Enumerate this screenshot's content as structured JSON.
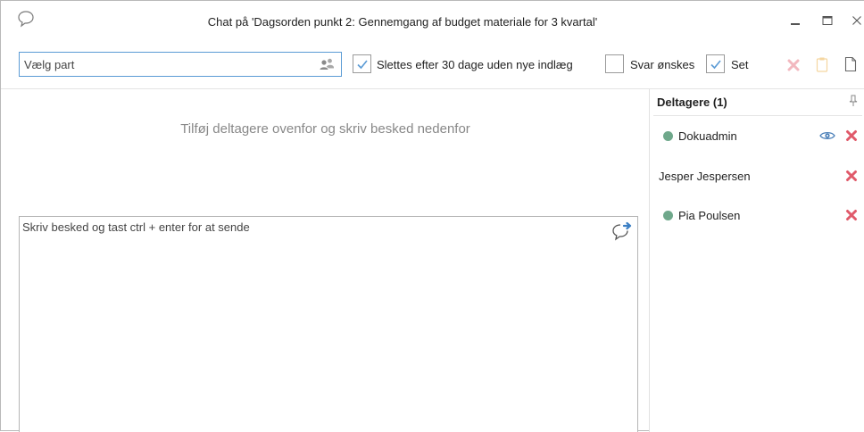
{
  "window": {
    "title": "Chat på 'Dagsorden punkt 2: Gennemgang af budget materiale for 3 kvartal'",
    "icon": "chat-bubble-icon",
    "controls": [
      "minimize-icon",
      "maximize-icon",
      "close-icon"
    ]
  },
  "toolbar": {
    "party_placeholder": "Vælg part",
    "party_icon": "people-icon",
    "delete_after_label": "Slettes efter 30 dage uden nye indlæg",
    "delete_after_checked": true,
    "reply_wanted_label": "Svar ønskes",
    "reply_wanted_checked": false,
    "seen_label": "Set",
    "seen_checked": true,
    "action_icons": [
      "delete-icon",
      "clipboard-icon",
      "document-icon"
    ]
  },
  "main": {
    "hint": "Tilføj deltagere ovenfor og skriv besked nedenfor",
    "message_placeholder": "Skriv besked og tast ctrl + enter for at sende",
    "send_icon": "send-message-icon"
  },
  "participants_panel": {
    "header": "Deltagere (1)",
    "pin_icon": "pin-icon",
    "participants": [
      {
        "name": "Dokuadmin",
        "online": true,
        "seen": true
      },
      {
        "name": "Jesper Jespersen",
        "online": false,
        "seen": false
      },
      {
        "name": "Pia Poulsen",
        "online": true,
        "seen": false
      }
    ]
  },
  "colors": {
    "accent": "#5b9bd5",
    "online_dot": "#6fa88b",
    "remove": "#e05a6a",
    "hint_text": "#888888"
  }
}
